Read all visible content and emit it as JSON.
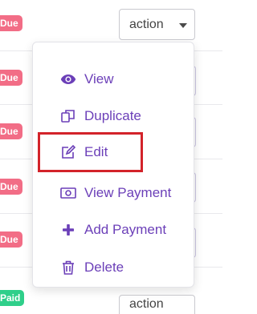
{
  "table": {
    "badges": [
      {
        "label": "Due",
        "status": "due"
      },
      {
        "label": "Due",
        "status": "due"
      },
      {
        "label": "Due",
        "status": "due"
      },
      {
        "label": "Due",
        "status": "due"
      },
      {
        "label": "Due",
        "status": "due"
      },
      {
        "label": "Paid",
        "status": "paid"
      }
    ],
    "action_select_label": "action",
    "bottom_select_label": "action"
  },
  "menu": {
    "items": [
      {
        "label": "View",
        "icon": "eye-icon"
      },
      {
        "label": "Duplicate",
        "icon": "duplicate-icon"
      },
      {
        "label": "Edit",
        "icon": "edit-icon"
      },
      {
        "label": "View Payment",
        "icon": "money-icon"
      },
      {
        "label": "Add Payment",
        "icon": "plus-icon"
      },
      {
        "label": "Delete",
        "icon": "trash-icon"
      }
    ]
  },
  "colors": {
    "menu_text": "#6b3fb8",
    "due_badge": "#f26d86",
    "paid_badge": "#2fcf8a",
    "highlight": "#d3232a"
  }
}
